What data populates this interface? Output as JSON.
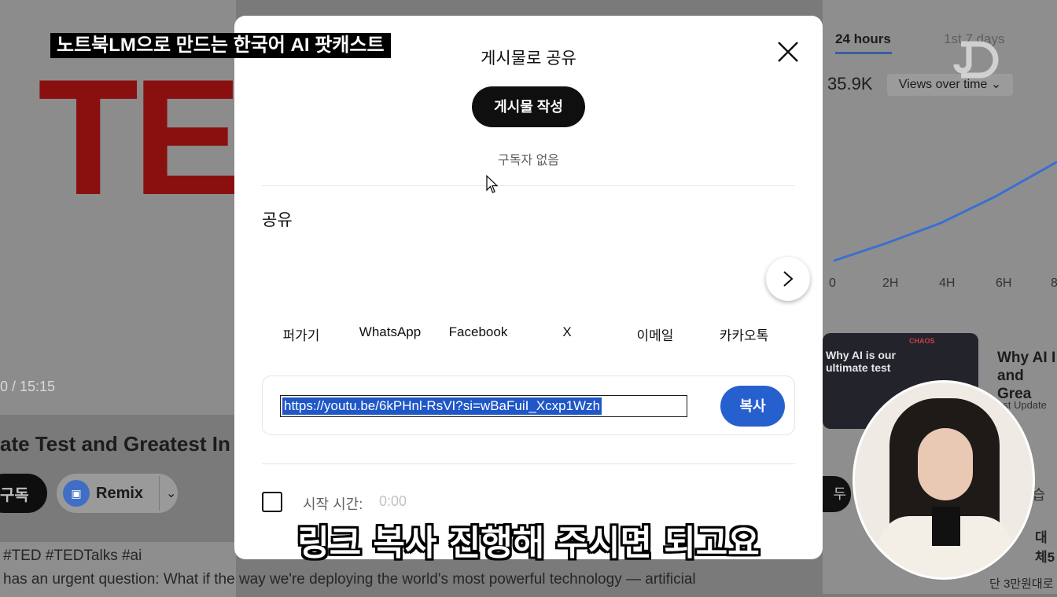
{
  "overlay_caption": "노트북LM으로 만드는 한국어 AI 팟캐스트",
  "subtitle": "링크 복사 진행해 주시면 되고요",
  "background": {
    "logo_text": "TEI",
    "video_time": "0 / 15:15",
    "video_title": "ate Test and Greatest In",
    "subscribe_label": "구독",
    "remix_label": "Remix",
    "tags": "#TED #TEDTalks #ai",
    "description": "has an urgent question: What if the way we're deploying the world's most powerful technology — artificial"
  },
  "right_panel": {
    "tab_24h": "24 hours",
    "tab_7d": "1st 7 days",
    "views_value": "35.9K",
    "views_dropdown": "Views over time",
    "axis_labels": [
      "0",
      "2H",
      "4H",
      "6H",
      "8"
    ],
    "thumb_text": "Why AI is our ultimate test",
    "thumb_brand": "CHAOS",
    "related_title": "Why AI I and Grea",
    "related_sub": "ast Update",
    "low_btn": "두",
    "low_btn2": "학습",
    "low_text1": "대체5",
    "low_text2": "단 3만원대로"
  },
  "modal": {
    "title": "게시물로 공유",
    "create_post_label": "게시물 작성",
    "no_subscribers": "구독자 없음",
    "share_label": "공유",
    "share_targets": [
      "퍼가기",
      "WhatsApp",
      "Facebook",
      "X",
      "이메일",
      "카카오톡"
    ],
    "url": "https://youtu.be/6kPHnl-RsVI?si=wBaFuiI_Xcxp1Wzh",
    "copy_label": "복사",
    "start_time_label": "시작 시간:",
    "start_time_value": "0:00"
  },
  "colors": {
    "accent_blue": "#2660ce",
    "ted_red": "#8a1010",
    "chart_line": "#3a6fcf"
  }
}
